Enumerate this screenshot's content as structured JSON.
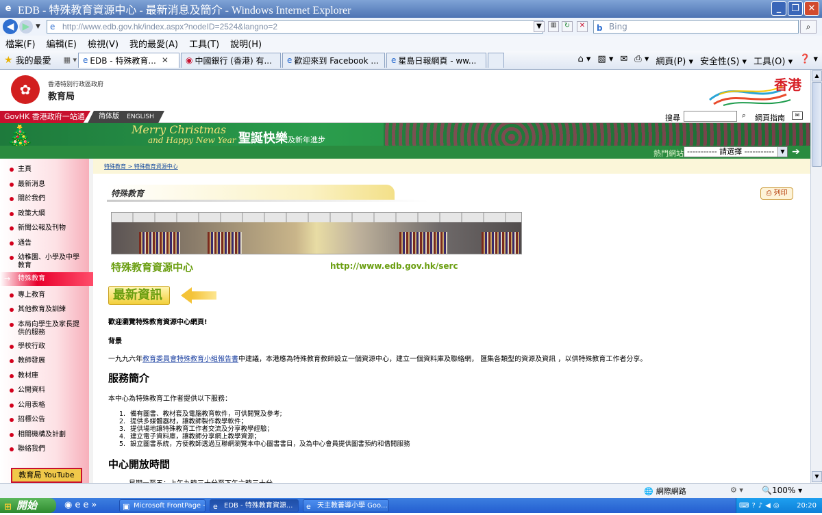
{
  "window": {
    "title": "EDB - 特殊教育資源中心 - 最新消息及簡介 - Windows Internet Explorer",
    "icon": "ie-icon",
    "buttons": [
      "minimize",
      "maximize",
      "close"
    ]
  },
  "address_bar": {
    "url": "http://www.edb.gov.hk/index.aspx?nodeID=2524&langno=2",
    "search_placeholder": "Bing"
  },
  "menu": [
    "檔案(F)",
    "編輯(E)",
    "檢視(V)",
    "我的最愛(A)",
    "工具(T)",
    "說明(H)"
  ],
  "favorites_label": "我的最愛",
  "tabs": [
    {
      "label": "EDB - 特殊教育...",
      "active": true
    },
    {
      "label": "中國銀行 (香港) 有...",
      "active": false
    },
    {
      "label": "歡迎來到 Facebook ...",
      "active": false
    },
    {
      "label": "星島日報網頁 - ww...",
      "active": false
    }
  ],
  "toolbar": {
    "page": "網頁(P)",
    "safety": "安全性(S)",
    "tools": "工具(O)"
  },
  "site": {
    "gov_small": "香港特別行政區政府",
    "gov_dept": "教育局",
    "hk_logo": "香港",
    "govhk": "GovHK 香港政府一站通",
    "lang_sc": "简体版",
    "lang_en": "ENGLISH",
    "search_label": "搜尋",
    "sitemap": "網頁指南",
    "banner_en1": "Merry Christmas",
    "banner_en2": "and Happy New Year",
    "banner_cn": "聖誕快樂",
    "banner_cn_small": "及新年進步",
    "hot_label": "熱門網站",
    "hot_select": "----------- 請選擇 -----------"
  },
  "sidebar": {
    "items": [
      "主頁",
      "最新消息",
      "關於我們",
      "政策大綱",
      "新聞公報及刊物",
      "通告",
      "幼稚園、小學及中學教育",
      "特殊教育",
      "專上教育",
      "其他教育及訓練",
      "本局向學生及家長提供的服務",
      "學校行政",
      "教師發展",
      "教材庫",
      "公開資料",
      "公用表格",
      "招標公告",
      "相關機構及計劃",
      "聯絡我們"
    ],
    "active_index": 7,
    "youtube": "教育局 YouTube"
  },
  "main": {
    "breadcrumb": "特殊教育 > 特殊教育資源中心",
    "section_title": "特殊教育",
    "print": "列印",
    "serc_name": "特殊教育資源中心",
    "serc_url": "http://www.edb.gov.hk/serc",
    "latest": "最新資訊",
    "welcome": "歡迎瀏覽特殊教育資源中心網頁!",
    "background_heading": "背景",
    "bg_pre": "一九九六年",
    "bg_link": "教育委員會特殊教育小組報告書",
    "bg_post": "中建議，本港應為特殊教育教師設立一個資源中心，建立一個資料庫及聯絡網， 匯集各類型的資源及資訊 ，以供特殊教育工作者分享。",
    "services_heading": "服務簡介",
    "services_intro": "本中心為特殊教育工作者提供以下服務：",
    "services": [
      "備有圖書、教材套及電腦教育軟件，可供閱覽及參考;",
      "提供多媒體器材，讓教師製作教學軟件；",
      "提供場地讓特殊教育工作者交流及分享教學經驗；",
      "建立電子資料庫，讓教師分享網上教學資源；",
      "設立圖書系統，方便教師透過互聯網瀏覽本中心圖書書目，及為中心會員提供圖書預約和借閱服務"
    ],
    "hours_heading": "中心開放時間",
    "hours_line": "星期一至五：上午九時三十分至下午六時三十分"
  },
  "status": {
    "zone": "網際網路",
    "zoom": "100%"
  },
  "taskbar": {
    "start": "開始",
    "buttons": [
      "Microsoft FrontPage - ...",
      "EDB - 特殊教育資源...",
      "天主教善導小學 Goo..."
    ],
    "active_index": 1,
    "clock": "20:20"
  }
}
